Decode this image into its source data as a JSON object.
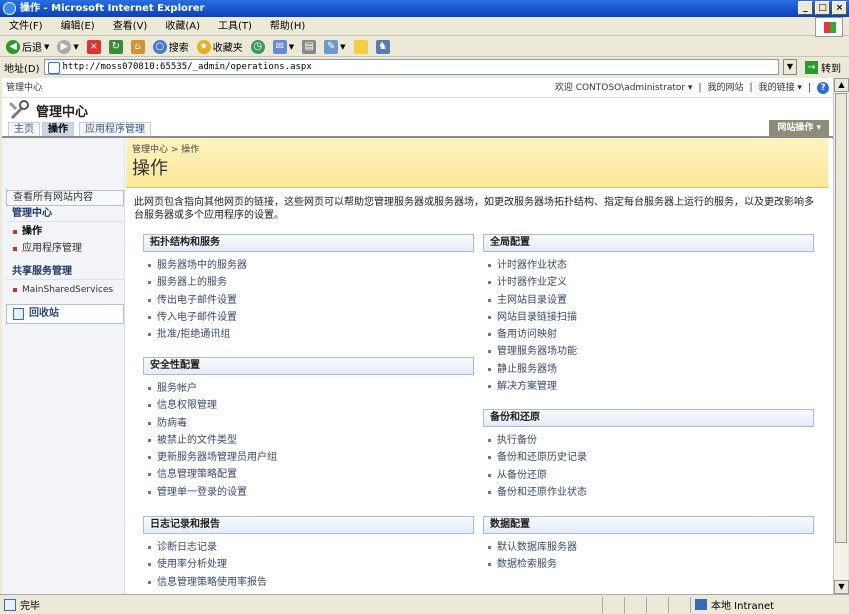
{
  "window": {
    "title": "操作 - Microsoft Internet Explorer",
    "buttons": [
      "_",
      "□",
      "×"
    ]
  },
  "menu": [
    "文件(F)",
    "编辑(E)",
    "查看(V)",
    "收藏(A)",
    "工具(T)",
    "帮助(H)"
  ],
  "toolbar": {
    "back": "后退",
    "search": "搜索",
    "favorites": "收藏夹"
  },
  "address": {
    "label": "地址(D)",
    "url": "http://moss070810:65535/_admin/operations.aspx",
    "go": "转到"
  },
  "sp": {
    "site_crumb": "管理中心",
    "welcome": "欢迎 CONTOSO\\administrator ▾",
    "my_site": "我的网站",
    "my_links": "我的链接 ▾",
    "help": "?",
    "title": "管理中心",
    "tabs": [
      "主页",
      "操作",
      "应用程序管理"
    ],
    "site_actions": "网站操作 ▾",
    "breadcrumb": "管理中心 > 操作",
    "page_title": "操作",
    "description": "此网页包含指向其他网页的链接，这些网页可以帮助您管理服务器或服务器场，如更改服务器场拓扑结构、指定每台服务器上运行的服务，以及更改影响多台服务器或多个应用程序的设置。",
    "nav": {
      "view_all": "查看所有网站内容",
      "sec1": "管理中心",
      "items1": [
        "操作",
        "应用程序管理"
      ],
      "sec2": "共享服务管理",
      "items2": [
        "MainSharedServices"
      ],
      "recycle": "回收站"
    },
    "sections": {
      "topology": {
        "title": "拓扑结构和服务",
        "links": [
          "服务器场中的服务器",
          "服务器上的服务",
          "传出电子邮件设置",
          "传入电子邮件设置",
          "批准/拒绝通讯组"
        ]
      },
      "security": {
        "title": "安全性配置",
        "links": [
          "服务帐户",
          "信息权限管理",
          "防病毒",
          "被禁止的文件类型",
          "更新服务器场管理员用户组",
          "信息管理策略配置",
          "管理单一登录的设置"
        ]
      },
      "logging": {
        "title": "日志记录和报告",
        "links": [
          "诊断日志记录",
          "使用率分析处理",
          "信息管理策略使用率报告"
        ]
      },
      "global": {
        "title": "全局配置",
        "links": [
          "计时器作业状态",
          "计时器作业定义",
          "主网站目录设置",
          "网站目录链接扫描",
          "备用访问映射",
          "管理服务器场功能",
          "静止服务器场",
          "解决方案管理"
        ]
      },
      "backup": {
        "title": "备份和还原",
        "links": [
          "执行备份",
          "备份和还原历史记录",
          "从备份还原",
          "备份和还原作业状态"
        ]
      },
      "data": {
        "title": "数据配置",
        "links": [
          "默认数据库服务器",
          "数据检索服务"
        ]
      }
    }
  },
  "status": {
    "left": "完毕",
    "zone": "本地 Intranet"
  }
}
